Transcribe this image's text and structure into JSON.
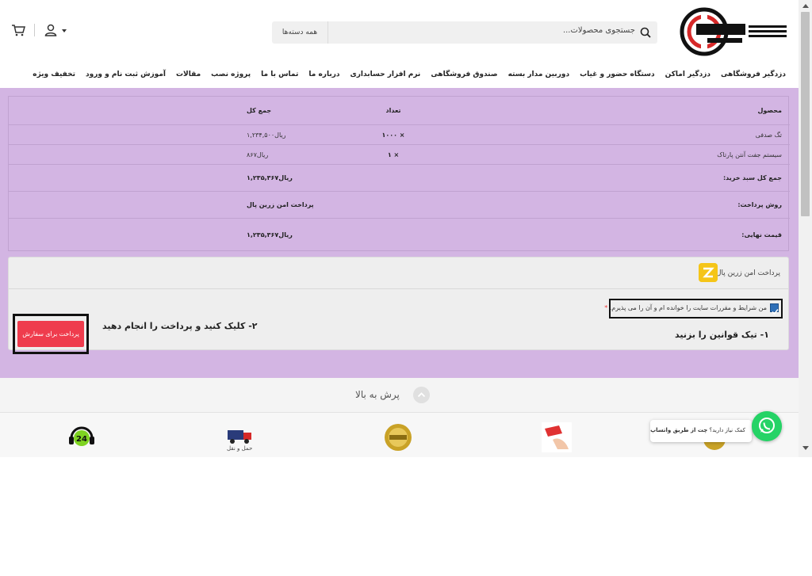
{
  "header": {
    "search_placeholder": "جستجوی محصولات...",
    "categories_label": "همه دسته‌ها"
  },
  "nav": [
    "دزدگیر فروشگاهی",
    "دزدگیر اماکن",
    "دستگاه حضور و غیاب",
    "دوربین مدار بسته",
    "صندوق فروشگاهی",
    "نرم افزار حسابداری",
    "درباره ما",
    "تماس با ما",
    "پروژه نصب",
    "مقالات",
    "آموزش ثبت نام و ورود",
    "تخفیف ویژه"
  ],
  "order": {
    "headers": {
      "product": "محصول",
      "qty": "تعداد",
      "total": "جمع کل"
    },
    "items": [
      {
        "name": "تگ صدفی",
        "qty": "× ۱۰۰۰",
        "total": "ریال۱,۲۳۴,۵۰۰"
      },
      {
        "name": "سیستم جفت آنتن پارتاک",
        "qty": "× ۱",
        "total": "ریال۸۶۷"
      }
    ],
    "subtotal_label": "جمع کل سبد خرید:",
    "subtotal_value": "ریال۱,۲۳۵,۳۶۷",
    "method_label": "روش پرداخت:",
    "method_value": "پرداخت امن زرین پال",
    "final_label": "قیمت نهایی:",
    "final_value": "ریال۱,۲۳۵,۳۶۷"
  },
  "payment": {
    "gateway_label": "پرداخت امن زرین پال",
    "terms_text": "من شرایط و مقررات سایت را خوانده ام و آن را می پذیرم.",
    "terms_required": "*",
    "terms_checked": true,
    "step1": "۱- تیک قوانین را بزنید",
    "step2": "۲- کلیک کنید و پرداخت را انجام دهید",
    "submit_label": "پرداخت برای سفارش"
  },
  "backtop_label": "پرش به بالا",
  "features": [
    {
      "icon": "support-24-icon",
      "label": ""
    },
    {
      "icon": "shipping-icon",
      "label": "حمل و نقل"
    },
    {
      "icon": "guarantee-badge-icon",
      "label": ""
    },
    {
      "icon": "discount-tag-icon",
      "label": ""
    }
  ],
  "whatsapp": {
    "text_prefix": "کمک نیاز دارید؟",
    "text_bold": "چت از طریق واتساپ"
  },
  "colors": {
    "section_bg": "#d3b5e3",
    "pay_button": "#ef3c4d",
    "whatsapp": "#25d366",
    "zarinpal": "#f5c518"
  }
}
